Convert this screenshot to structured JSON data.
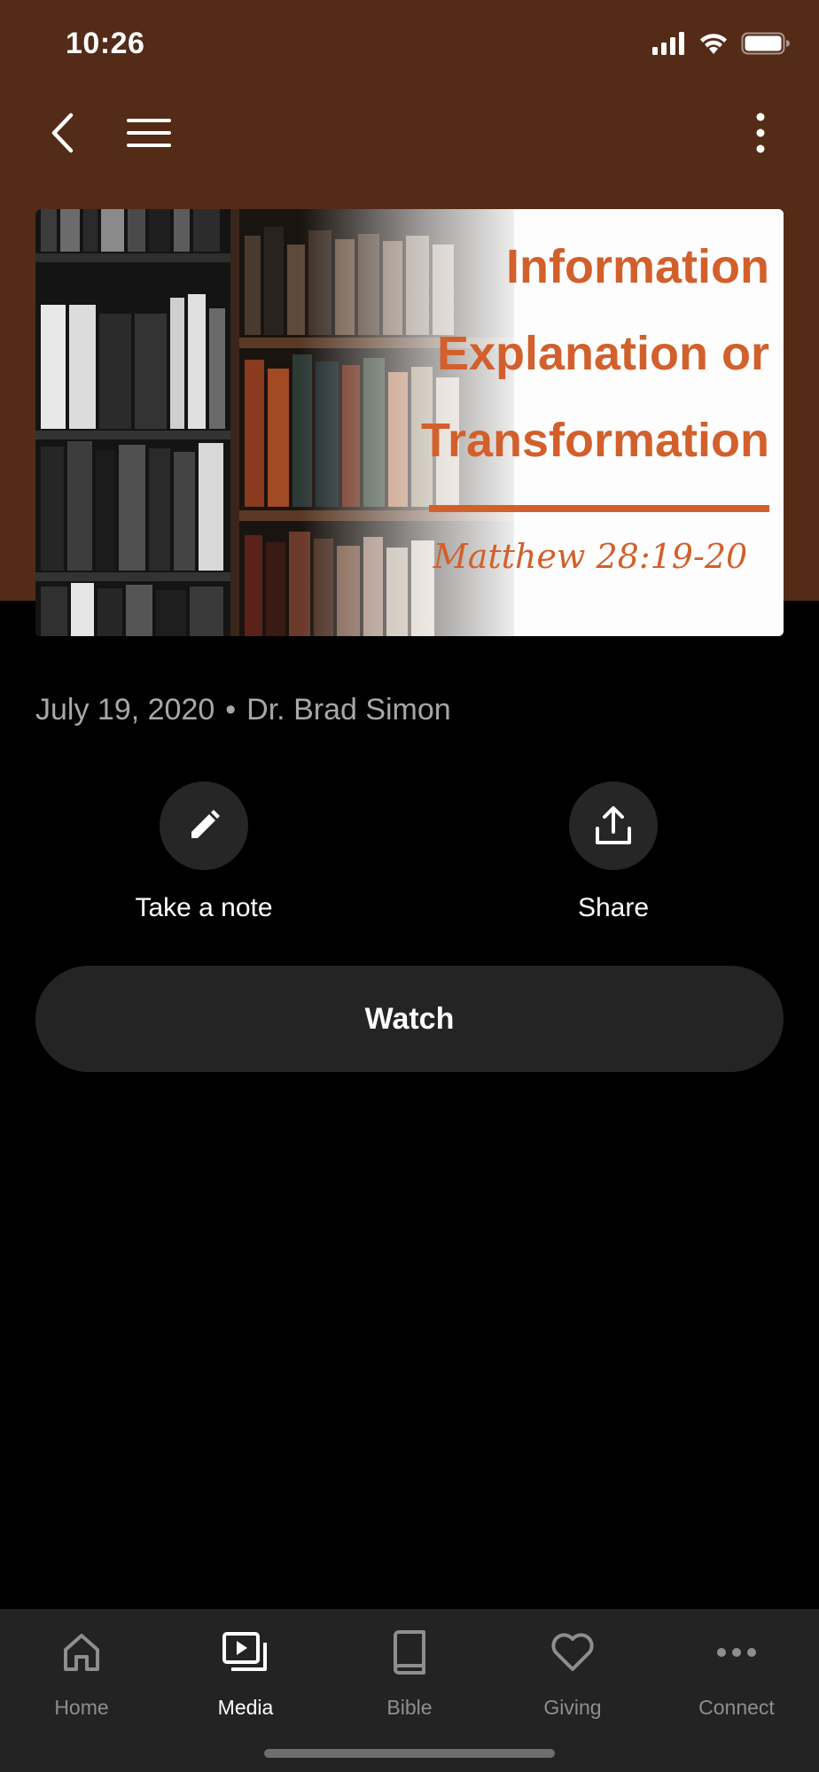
{
  "status_bar": {
    "time": "10:26"
  },
  "hero": {
    "title_lines": [
      "Information",
      "Explanation or",
      "Transformation"
    ],
    "reference": "Matthew 28:19-20"
  },
  "sermon": {
    "date": "July 19, 2020",
    "separator": "•",
    "speaker": "Dr. Brad Simon"
  },
  "actions": {
    "note_label": "Take a note",
    "share_label": "Share"
  },
  "watch_label": "Watch",
  "tabs": [
    {
      "label": "Home",
      "icon": "home-icon"
    },
    {
      "label": "Media",
      "icon": "media-icon",
      "active": true
    },
    {
      "label": "Bible",
      "icon": "book-icon"
    },
    {
      "label": "Giving",
      "icon": "heart-icon"
    },
    {
      "label": "Connect",
      "icon": "more-icon"
    }
  ],
  "colors": {
    "header": "#542b17",
    "accent": "#d2602c",
    "tabbar": "#232323"
  }
}
